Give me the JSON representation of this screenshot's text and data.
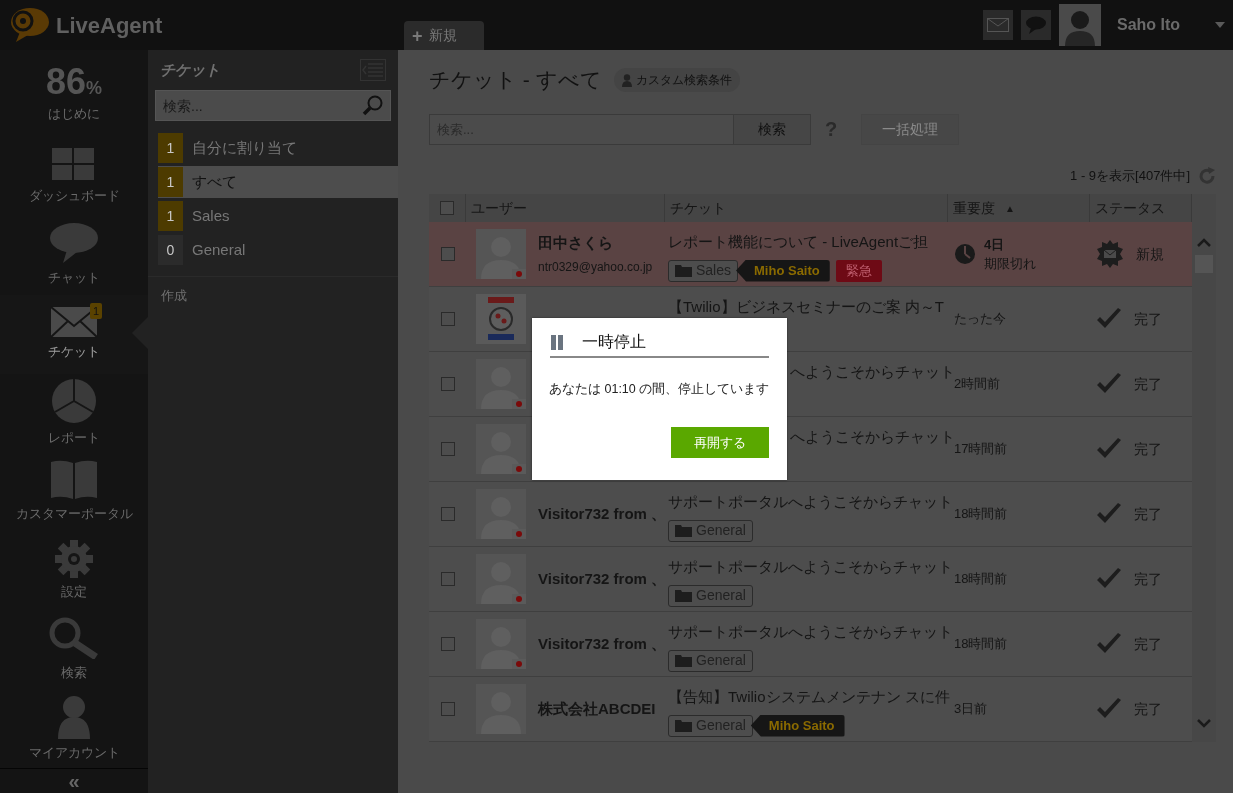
{
  "topbar": {
    "logo": "LiveAgent",
    "new_tab": {
      "icon": "+",
      "label": "新規"
    },
    "user_name": "Saho Ito"
  },
  "nav": {
    "progress": {
      "value": "86",
      "unit": "%",
      "label": "はじめに"
    },
    "items": [
      {
        "kind": "dashboard",
        "label": "ダッシュボード",
        "selected": false
      },
      {
        "kind": "chat",
        "label": "チャット",
        "selected": false
      },
      {
        "kind": "ticket",
        "label": "チケット",
        "selected": true,
        "badge": "1"
      },
      {
        "kind": "report",
        "label": "レポート",
        "selected": false
      },
      {
        "kind": "portal",
        "label": "カスタマーポータル",
        "selected": false
      },
      {
        "kind": "settings",
        "label": "設定",
        "selected": false
      },
      {
        "kind": "search",
        "label": "検索",
        "selected": false
      },
      {
        "kind": "account",
        "label": "マイアカウント",
        "selected": false
      }
    ],
    "collapse": "«"
  },
  "panel": {
    "title": "チケット",
    "search_placeholder": "検索...",
    "filters": [
      {
        "count": "1",
        "label": "自分に割り当て",
        "selected": false,
        "color": "#4d3b00"
      },
      {
        "count": "1",
        "label": "すべて",
        "selected": true,
        "color": "#4d3b00"
      },
      {
        "count": "1",
        "label": "Sales",
        "selected": false,
        "color": "#4d3b00"
      },
      {
        "count": "0",
        "label": "General",
        "selected": false,
        "color": "#2b2b2b"
      }
    ],
    "create": "作成"
  },
  "main": {
    "title": "チケット - すべて",
    "custom_filter": "カスタム検索条件",
    "search_placeholder": "検索...",
    "search_button": "検索",
    "help": "?",
    "bulk_button": {
      "label": "一括処理",
      "disabled": true
    },
    "range": "1 - 9を表示[407件中]",
    "select_all": {
      "checked": false
    },
    "table": {
      "columns": [
        "ユーザー",
        "チケット",
        "重要度",
        "ステータス"
      ],
      "sort_mark": "▲",
      "rows": [
        {
          "kind": "person",
          "checked": false,
          "flag": true,
          "name": "田中さくら",
          "email": "ntr0329@yahoo.co.jp",
          "subject": "レポート機能について - LiveAgentご担",
          "tags": [
            {
              "kind": "department",
              "label": "Sales"
            },
            {
              "kind": "agent",
              "label": "Miho Saito"
            },
            {
              "kind": "priority",
              "label": "緊急"
            }
          ],
          "overdue": true,
          "time": "4日",
          "time_note": "期限切れ",
          "status": {
            "kind": "new",
            "label": "新規"
          }
        },
        {
          "kind": "logo",
          "checked": false,
          "flag": false,
          "subject": "【Twilio】ビジネスセミナーのご案 内～T",
          "tags": [],
          "overdue": false,
          "time": "たった今",
          "status": {
            "kind": "resolved",
            "label": "完了"
          }
        },
        {
          "kind": "person",
          "checked": false,
          "flag": true,
          "subject": "へようこそからチャット",
          "tags": [],
          "overdue": false,
          "time": "2時間前",
          "status": {
            "kind": "resolved",
            "label": "完了"
          }
        },
        {
          "kind": "person",
          "checked": false,
          "flag": true,
          "subject": "へようこそからチャット",
          "tags": [],
          "overdue": false,
          "time": "17時間前",
          "status": {
            "kind": "resolved",
            "label": "完了"
          }
        },
        {
          "kind": "person",
          "checked": false,
          "flag": true,
          "name": "Visitor732 from 、",
          "subject": "サポートポータルへようこそからチャット",
          "tags": [
            {
              "kind": "department",
              "label": "General"
            }
          ],
          "overdue": false,
          "time": "18時間前",
          "status": {
            "kind": "resolved",
            "label": "完了"
          }
        },
        {
          "kind": "person",
          "checked": false,
          "flag": true,
          "name": "Visitor732 from 、",
          "subject": "サポートポータルへようこそからチャット",
          "tags": [
            {
              "kind": "department",
              "label": "General"
            }
          ],
          "overdue": false,
          "time": "18時間前",
          "status": {
            "kind": "resolved",
            "label": "完了"
          }
        },
        {
          "kind": "person",
          "checked": false,
          "flag": true,
          "name": "Visitor732 from 、",
          "subject": "サポートポータルへようこそからチャット",
          "tags": [
            {
              "kind": "department",
              "label": "General"
            }
          ],
          "overdue": false,
          "time": "18時間前",
          "status": {
            "kind": "resolved",
            "label": "完了"
          }
        },
        {
          "kind": "person",
          "checked": false,
          "flag": false,
          "name": "株式会社ABCDEI",
          "subject": "【告知】Twilioシステムメンテナン スに件",
          "tags": [
            {
              "kind": "department",
              "label": "General"
            },
            {
              "kind": "agent",
              "label": "Miho Saito"
            }
          ],
          "overdue": false,
          "time": "3日前",
          "status": {
            "kind": "resolved",
            "label": "完了"
          }
        }
      ]
    }
  },
  "dialog": {
    "title": "一時停止",
    "message": "あなたは 01:10 の間、停止しています",
    "button": "再開する"
  }
}
